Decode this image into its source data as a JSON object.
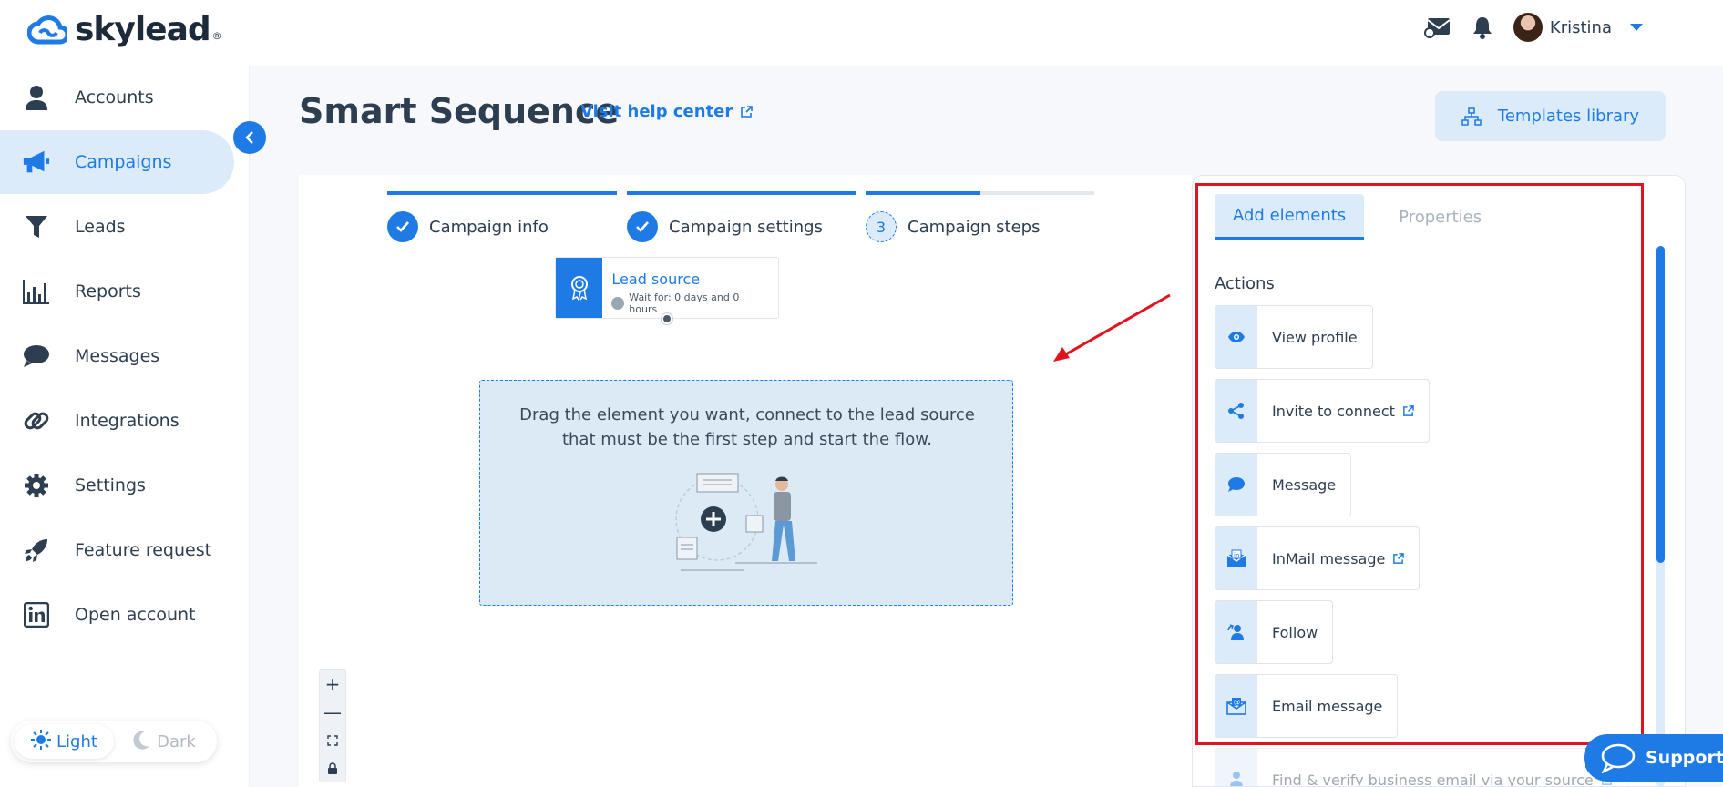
{
  "brand": {
    "name": "skylead",
    "reg": "®"
  },
  "header": {
    "user_name": "Kristina"
  },
  "sidebar": {
    "items": [
      {
        "label": "Accounts",
        "icon": "user-icon"
      },
      {
        "label": "Campaigns",
        "icon": "megaphone-icon",
        "active": true
      },
      {
        "label": "Leads",
        "icon": "funnel-icon"
      },
      {
        "label": "Reports",
        "icon": "bar-chart-icon"
      },
      {
        "label": "Messages",
        "icon": "chat-bubble-icon"
      },
      {
        "label": "Integrations",
        "icon": "link-icon"
      },
      {
        "label": "Settings",
        "icon": "gear-icon"
      },
      {
        "label": "Feature request",
        "icon": "rocket-icon"
      },
      {
        "label": "Open account",
        "icon": "linkedin-icon"
      }
    ],
    "theme": {
      "light": "Light",
      "dark": "Dark",
      "selected": "Light"
    }
  },
  "main": {
    "title": "Smart Sequence",
    "help_link": "Visit help center",
    "templates_button": "Templates library",
    "steps": [
      {
        "label": "Campaign info",
        "state": "done",
        "progress": 1.0
      },
      {
        "label": "Campaign settings",
        "state": "done",
        "progress": 1.0
      },
      {
        "label": "Campaign steps",
        "state": "current",
        "number": "3",
        "progress": 0.5
      }
    ],
    "lead_source": {
      "title": "Lead source",
      "wait": "Wait for: 0 days and 0 hours"
    },
    "dropzone_text": "Drag the element you want, connect to the lead source that must be the first step and start the flow."
  },
  "panel": {
    "tabs": [
      {
        "label": "Add elements",
        "active": true
      },
      {
        "label": "Properties",
        "active": false
      }
    ],
    "section_title": "Actions",
    "actions": [
      {
        "label": "View profile",
        "icon": "eye-icon",
        "external": false
      },
      {
        "label": "Invite to connect",
        "icon": "share-icon",
        "external": true
      },
      {
        "label": "Message",
        "icon": "chat-bubble-icon",
        "external": false
      },
      {
        "label": "InMail message",
        "icon": "inmail-icon",
        "external": true
      },
      {
        "label": "Follow",
        "icon": "follow-user-icon",
        "external": false
      },
      {
        "label": "Email message",
        "icon": "email-icon",
        "external": false
      },
      {
        "label": "Find & verify business email via your source",
        "icon": "person-search-icon",
        "external": true
      }
    ]
  },
  "support": {
    "label": "Support"
  },
  "colors": {
    "accent": "#1e7be6",
    "accent_light": "#dcebf9",
    "highlight": "#e0141e"
  }
}
